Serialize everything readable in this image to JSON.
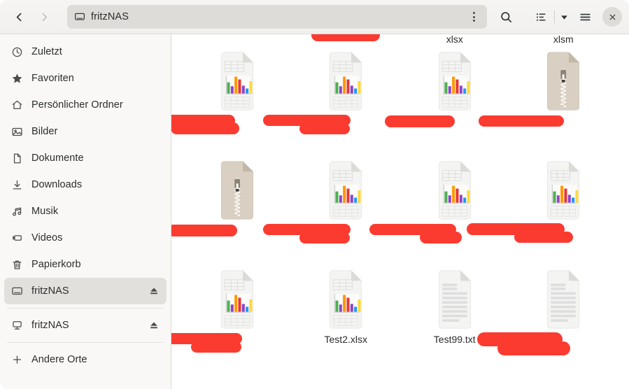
{
  "window": {
    "title": "fritzNAS"
  },
  "header": {
    "back_tooltip": "Zurück",
    "forward_tooltip": "Vor",
    "path_label": "fritzNAS",
    "path_icon": "drive-icon",
    "kebab_name": "path-options-icon",
    "search_icon": "search-icon",
    "view_list_icon": "list-view-icon",
    "view_dropdown_icon": "chevron-down-icon",
    "menu_icon": "hamburger-menu-icon",
    "close_icon": "close-icon"
  },
  "sidebar": {
    "items": [
      {
        "label": "Zuletzt",
        "icon": "clock-icon",
        "selected": false,
        "eject": false
      },
      {
        "label": "Favoriten",
        "icon": "star-icon",
        "selected": false,
        "eject": false
      },
      {
        "label": "Persönlicher Ordner",
        "icon": "home-icon",
        "selected": false,
        "eject": false
      },
      {
        "label": "Bilder",
        "icon": "image-icon",
        "selected": false,
        "eject": false
      },
      {
        "label": "Dokumente",
        "icon": "document-icon",
        "selected": false,
        "eject": false
      },
      {
        "label": "Downloads",
        "icon": "download-icon",
        "selected": false,
        "eject": false
      },
      {
        "label": "Musik",
        "icon": "music-icon",
        "selected": false,
        "eject": false
      },
      {
        "label": "Videos",
        "icon": "video-icon",
        "selected": false,
        "eject": false
      },
      {
        "label": "Papierkorb",
        "icon": "trash-icon",
        "selected": false,
        "eject": false
      },
      {
        "label": "fritzNAS",
        "icon": "drive-icon",
        "selected": true,
        "eject": true
      },
      {
        "label": "fritzNAS",
        "icon": "network-icon",
        "selected": false,
        "eject": true
      },
      {
        "label": "Andere Orte",
        "icon": "plus-icon",
        "selected": false,
        "eject": false
      }
    ],
    "separator_after": [
      9,
      10
    ]
  },
  "files": {
    "toprow_partial_labels": [
      "",
      "",
      "xlsx",
      "xlsm"
    ],
    "items": [
      {
        "name": "",
        "type": "spreadsheet",
        "redacted": true,
        "redact_style": "a"
      },
      {
        "name": "",
        "type": "spreadsheet",
        "redacted": true,
        "redact_style": "b"
      },
      {
        "name": "",
        "type": "spreadsheet",
        "redacted": true,
        "redact_style": "c"
      },
      {
        "name": "",
        "type": "archive",
        "redacted": true,
        "redact_style": "d"
      },
      {
        "name": "",
        "type": "archive",
        "redacted": true,
        "redact_style": "c"
      },
      {
        "name": "",
        "type": "spreadsheet",
        "redacted": true,
        "redact_style": "b"
      },
      {
        "name": "",
        "type": "spreadsheet",
        "redacted": true,
        "redact_style": "e"
      },
      {
        "name": "",
        "type": "spreadsheet",
        "redacted": true,
        "redact_style": "f"
      },
      {
        "name": "",
        "type": "spreadsheet",
        "redacted": true,
        "redact_style": "b"
      },
      {
        "name": "Test2.xlsx",
        "type": "spreadsheet",
        "redacted": false,
        "redact_style": ""
      },
      {
        "name": "Test99.txt",
        "type": "text",
        "redacted": false,
        "redact_style": ""
      },
      {
        "name": "",
        "type": "text",
        "redacted": true,
        "redact_style": "g"
      }
    ]
  },
  "colors": {
    "redaction": "#fb3b30",
    "sidebar_bg": "#f9f8f7",
    "header_bg": "#f1f0ee",
    "selected_bg": "#e2e0dd",
    "content_bg": "#ffffff",
    "chart_bars": [
      "#4caf50",
      "#8e44c8",
      "#ff9800",
      "#e53935",
      "#8e44c8",
      "#2196f3",
      "#ffd93b"
    ]
  }
}
